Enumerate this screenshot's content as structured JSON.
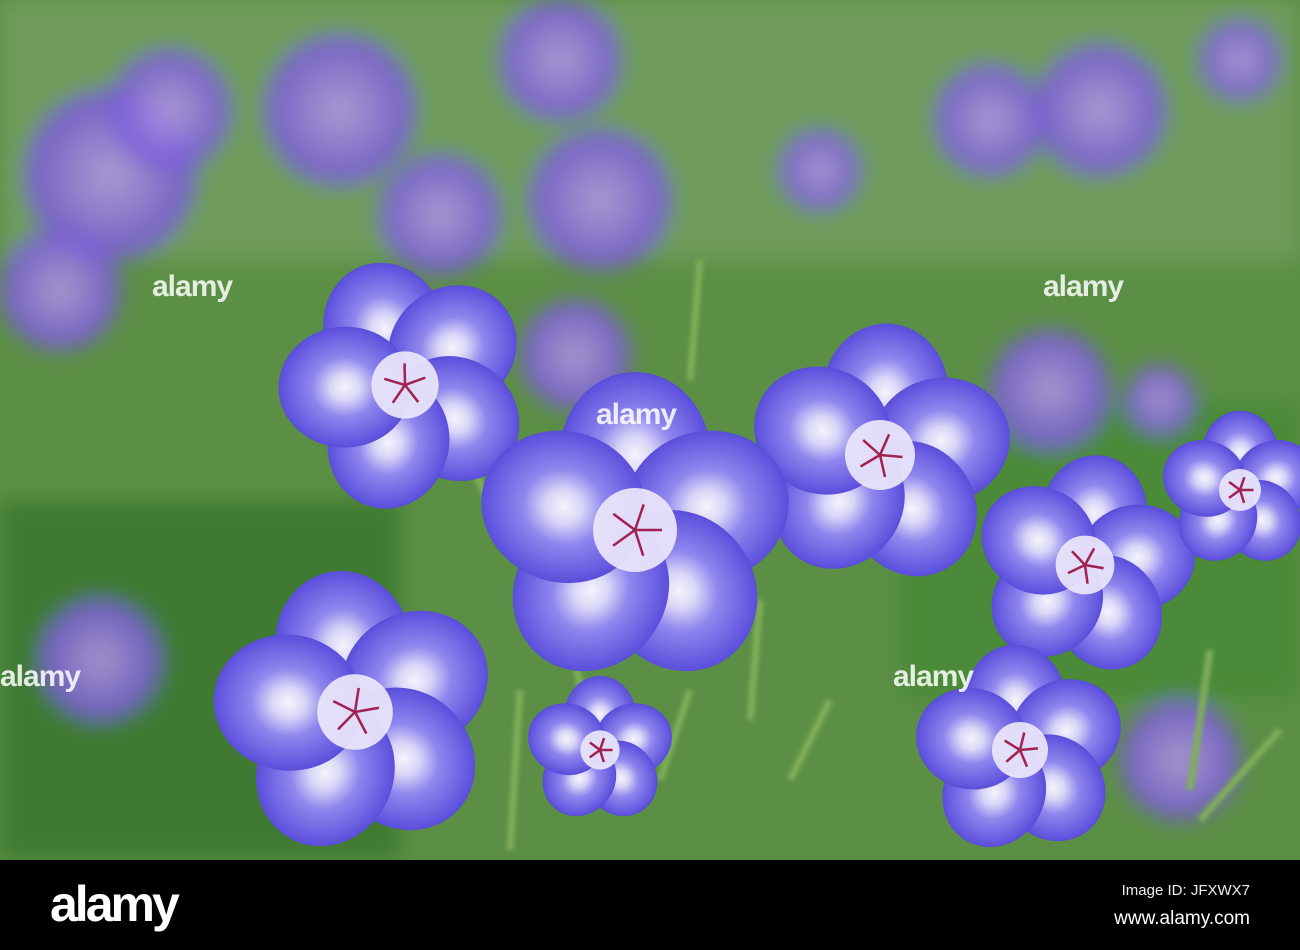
{
  "photo": {
    "subject": "purple geranium flowers",
    "watermark": "alamy",
    "colors": {
      "leaf": "#4f8a3a",
      "leaf_dark": "#2f5e24",
      "petal": "#6f62e6",
      "petal_light": "#b9b4f4",
      "center": "#f4f2fb",
      "stamen": "#a0204f"
    }
  },
  "footer": {
    "logo": "alamy",
    "image_id": "Image ID: JFXWX7",
    "website": "www.alamy.com"
  }
}
